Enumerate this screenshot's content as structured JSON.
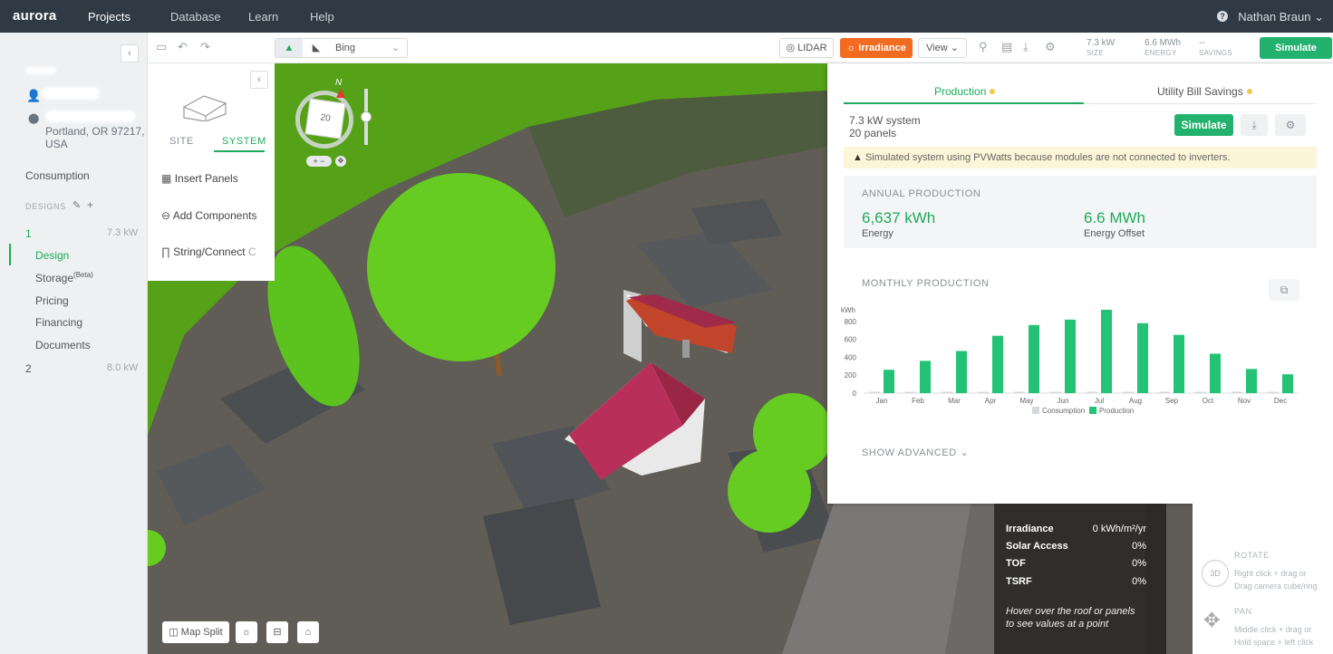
{
  "topnav": {
    "logo": "aurora",
    "items": [
      "Projects",
      "Database",
      "Learn",
      "Help"
    ],
    "user_name": "Nathan Braun",
    "help_icon": "question-icon"
  },
  "sidebar": {
    "address": "Portland, OR 97217,",
    "country": "USA",
    "consumption_label": "Consumption",
    "designs_label": "DESIGNS",
    "designs": [
      {
        "num": "1",
        "size": "7.3 kW"
      },
      {
        "num": "2",
        "size": "8.0 kW"
      }
    ],
    "subnav": {
      "design": "Design",
      "storage": "Storage",
      "storage_beta": "(Beta)",
      "pricing": "Pricing",
      "financing": "Financing",
      "documents": "Documents"
    }
  },
  "toolbar": {
    "map_source": "Bing",
    "lidar": "LIDAR",
    "irradiance": "Irradiance",
    "view": "View",
    "size_value": "7.3 kW",
    "size_label": "SIZE",
    "energy_value": "6.6 MWh",
    "energy_label": "ENERGY",
    "savings_value": "--",
    "savings_label": "SAVINGS",
    "simulate": "Simulate"
  },
  "system_panel": {
    "tab_site": "SITE",
    "tab_system": "SYSTEM",
    "insert_panels": "Insert Panels",
    "add_components": "Add Components",
    "string_connect": "String/Connect",
    "string_shortcut": "C"
  },
  "compass": {
    "north": "N",
    "cube_value": "20"
  },
  "production_panel": {
    "tab_production": "Production",
    "tab_savings": "Utility Bill Savings",
    "system_size": "7.3 kW system",
    "panels": "20 panels",
    "simulate": "Simulate",
    "warning": "Simulated system using PVWatts because modules are not connected to inverters.",
    "annual_heading": "ANNUAL PRODUCTION",
    "energy_value": "6,637 kWh",
    "energy_label": "Energy",
    "offset_value": "6.6 MWh",
    "offset_label": "Energy Offset",
    "monthly_heading": "MONTHLY PRODUCTION",
    "show_advanced": "SHOW ADVANCED"
  },
  "chart_data": {
    "type": "bar",
    "ylabel": "kWh",
    "ylim": [
      0,
      950
    ],
    "yticks": [
      0,
      200,
      400,
      600,
      800
    ],
    "categories": [
      "Jan",
      "Feb",
      "Mar",
      "Apr",
      "May",
      "Jun",
      "Jul",
      "Aug",
      "Sep",
      "Oct",
      "Nov",
      "Dec"
    ],
    "series": [
      {
        "name": "Consumption",
        "color": "#d5d8db",
        "values": [
          15,
          15,
          15,
          15,
          15,
          15,
          15,
          15,
          15,
          15,
          15,
          15
        ]
      },
      {
        "name": "Production",
        "color": "#23c275",
        "values": [
          260,
          360,
          470,
          640,
          760,
          820,
          930,
          780,
          650,
          440,
          270,
          210
        ]
      }
    ],
    "legend_position": "bottom"
  },
  "infobox": {
    "rows": [
      {
        "key": "Irradiance",
        "value": "0 kWh/m²/yr"
      },
      {
        "key": "Solar Access",
        "value": "0%"
      },
      {
        "key": "TOF",
        "value": "0%"
      },
      {
        "key": "TSRF",
        "value": "0%"
      }
    ],
    "hint": "Hover over the roof or panels to see values at a point"
  },
  "help_panel": {
    "rotate_title": "ROTATE",
    "rotate_line1": "Right click + drag or",
    "rotate_line2": "Drag camera cube/ring",
    "badge_3d": "3D",
    "pan_title": "PAN",
    "pan_line1": "Middle click + drag or",
    "pan_line2": "Hold space + left click"
  },
  "bottom_controls": {
    "map_split": "Map Split"
  }
}
